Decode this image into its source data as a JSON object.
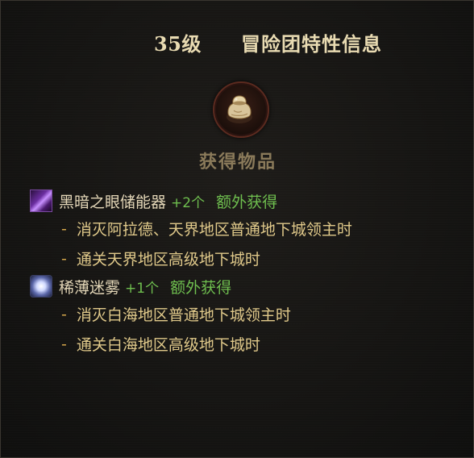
{
  "header": {
    "level": "35级",
    "title": "冒险团特性信息"
  },
  "emblem": {
    "icon": "treasure-bag-icon"
  },
  "section": {
    "title": "获得物品"
  },
  "colors": {
    "title_text": "#e9dbb2",
    "section_text": "#8a7a5a",
    "item_name": "#e4d7b8",
    "bonus_green": "#6fbf4f",
    "condition_text": "#e0c98a",
    "background": "#161513"
  },
  "items": [
    {
      "icon": "dark-eye-storage-icon",
      "name": "黑暗之眼储能器",
      "count": "+2个",
      "extra": "额外获得",
      "conditions": [
        {
          "dash": "-",
          "text": "消灭阿拉德、天界地区普通地下城领主时"
        },
        {
          "dash": "-",
          "text": "通关天界地区高级地下城时"
        }
      ]
    },
    {
      "icon": "thin-mist-icon",
      "name": "稀薄迷雾",
      "count": "+1个",
      "extra": "额外获得",
      "conditions": [
        {
          "dash": "-",
          "text": "消灭白海地区普通地下城领主时"
        },
        {
          "dash": "-",
          "text": "通关白海地区高级地下城时"
        }
      ]
    }
  ]
}
